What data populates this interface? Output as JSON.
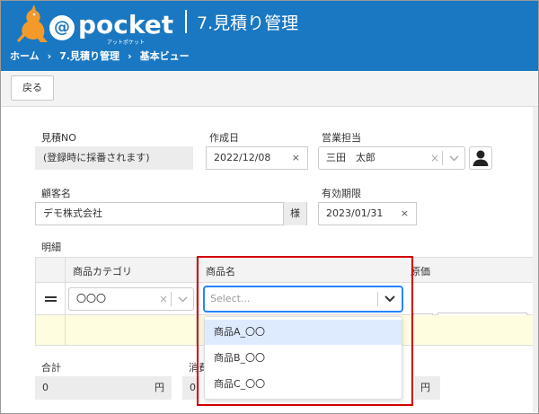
{
  "app": {
    "logo_at": "@",
    "logo_name": "pocket",
    "logo_sub": "アットポケット",
    "page_title": "7.見積り管理"
  },
  "breadcrumb": [
    "ホーム",
    "7.見積り管理",
    "基本ビュー"
  ],
  "breadcrumb_sep": "›",
  "toolbar": {
    "back_label": "戻る"
  },
  "form": {
    "quote_no_label": "見積NO",
    "quote_no_value": "(登録時に採番されます)",
    "created_label": "作成日",
    "created_value": "2022/12/08",
    "sales_label": "営業担当",
    "sales_value": "三田　太郎",
    "customer_label": "顧客名",
    "customer_value": "デモ株式会社",
    "customer_suffix": "様",
    "expiry_label": "有効期限",
    "expiry_value": "2023/01/31",
    "clear_glyph": "×"
  },
  "details": {
    "section_label": "明細",
    "col_category": "商品カテゴリ",
    "col_product": "商品名",
    "col_cost": "原価",
    "row_category_value": "〇〇〇"
  },
  "dropdown": {
    "placeholder": "Select...",
    "options": [
      "商品A_〇〇",
      "商品B_〇〇",
      "商品C_〇〇"
    ],
    "active_index": 0
  },
  "totals": {
    "total_label": "合計",
    "tax_label": "消費",
    "total_value": "0",
    "tax_value": "0",
    "unit": "円"
  },
  "colors": {
    "header_bg": "#1a78c2",
    "highlight": "#d40000"
  }
}
